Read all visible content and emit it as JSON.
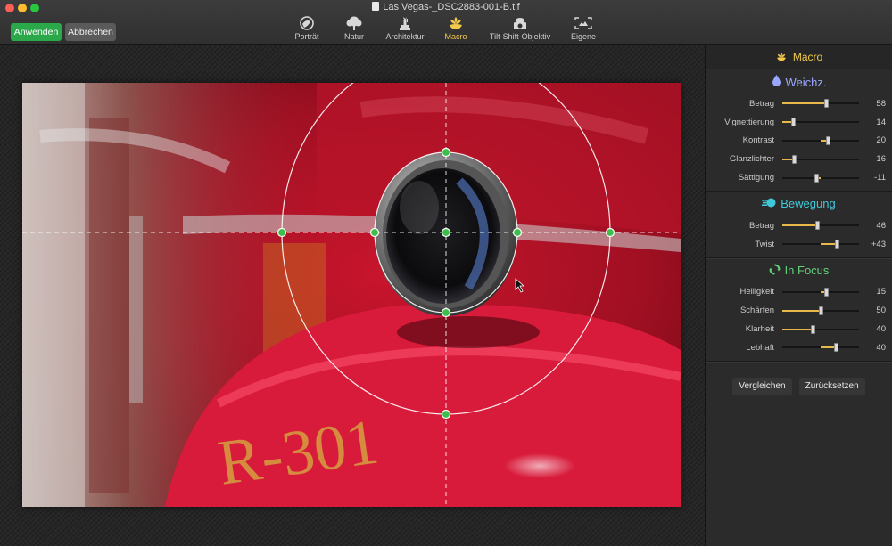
{
  "window": {
    "title": "Las Vegas-_DSC2883-001-B.tif"
  },
  "toolbar": {
    "apply_label": "Anwenden",
    "cancel_label": "Abbrechen",
    "modes": [
      {
        "label": "Porträt",
        "icon": "portrait-icon"
      },
      {
        "label": "Natur",
        "icon": "tree-icon"
      },
      {
        "label": "Architektur",
        "icon": "statue-icon"
      },
      {
        "label": "Macro",
        "icon": "flower-icon",
        "active": true
      },
      {
        "label": "Tilt-Shift-Objektiv",
        "icon": "camera-icon"
      },
      {
        "label": "Eigene",
        "icon": "custom-frame-icon"
      }
    ]
  },
  "panel": {
    "title": "Macro",
    "sections": [
      {
        "title": "Weichz.",
        "icon": "drop-icon",
        "sliders": [
          {
            "label": "Betrag",
            "value": "58",
            "pos": 0.58,
            "signed": false
          },
          {
            "label": "Vignettierung",
            "value": "14",
            "pos": 0.14,
            "signed": false
          },
          {
            "label": "Kontrast",
            "value": "20",
            "pos": 0.6,
            "signed": true
          },
          {
            "label": "Glanzlichter",
            "value": "16",
            "pos": 0.16,
            "signed": false
          },
          {
            "label": "Sättigung",
            "value": "-11",
            "pos": 0.445,
            "signed": true
          }
        ]
      },
      {
        "title": "Bewegung",
        "icon": "motion-icon",
        "sliders": [
          {
            "label": "Betrag",
            "value": "46",
            "pos": 0.46,
            "signed": false
          },
          {
            "label": "Twist",
            "value": "+43",
            "pos": 0.715,
            "signed": true
          }
        ]
      },
      {
        "title": "In Focus",
        "icon": "refresh-icon",
        "sliders": [
          {
            "label": "Helligkeit",
            "value": "15",
            "pos": 0.575,
            "signed": true
          },
          {
            "label": "Schärfen",
            "value": "50",
            "pos": 0.5,
            "signed": false
          },
          {
            "label": "Klarheit",
            "value": "40",
            "pos": 0.4,
            "signed": false
          },
          {
            "label": "Lebhaft",
            "value": "40",
            "pos": 0.7,
            "signed": true
          }
        ]
      }
    ],
    "compare_label": "Vergleichen",
    "reset_label": "Zurücksetzen"
  },
  "image": {
    "text": "R-301"
  },
  "colors": {
    "accent": "#f2c94c",
    "apply": "#2aa84a",
    "handle": "#3bbf4a"
  }
}
